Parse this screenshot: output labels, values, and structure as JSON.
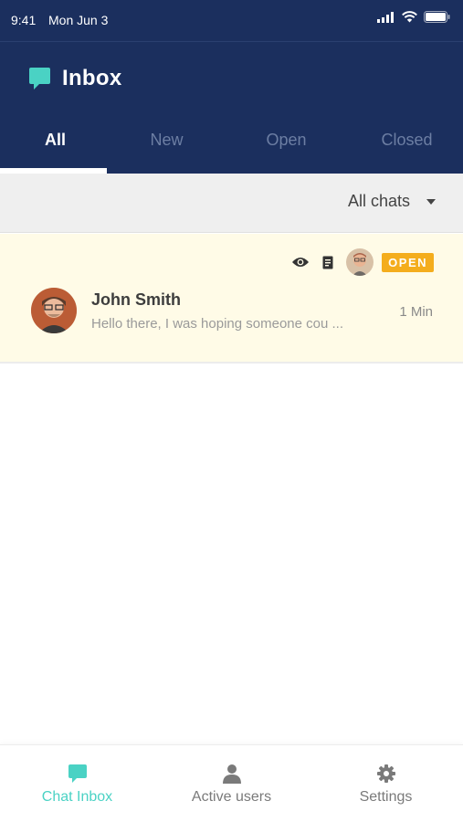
{
  "status_bar": {
    "time": "9:41",
    "date": "Mon Jun 3"
  },
  "header": {
    "title": "Inbox"
  },
  "tabs": [
    {
      "label": "All",
      "active": true
    },
    {
      "label": "New",
      "active": false
    },
    {
      "label": "Open",
      "active": false
    },
    {
      "label": "Closed",
      "active": false
    }
  ],
  "filter": {
    "selected": "All chats"
  },
  "chats": [
    {
      "name": "John Smith",
      "preview": "Hello there, I was hoping someone cou ...",
      "time": "1 Min",
      "status": "OPEN"
    }
  ],
  "bottom_nav": [
    {
      "label": "Chat Inbox",
      "icon": "chat-bubble-icon",
      "active": true
    },
    {
      "label": "Active users",
      "icon": "user-icon",
      "active": false
    },
    {
      "label": "Settings",
      "icon": "gear-icon",
      "active": false
    }
  ],
  "colors": {
    "header_bg": "#1b2f5e",
    "accent": "#4ad2c4",
    "badge": "#f4ad1d",
    "row_highlight": "#fffbe7"
  }
}
